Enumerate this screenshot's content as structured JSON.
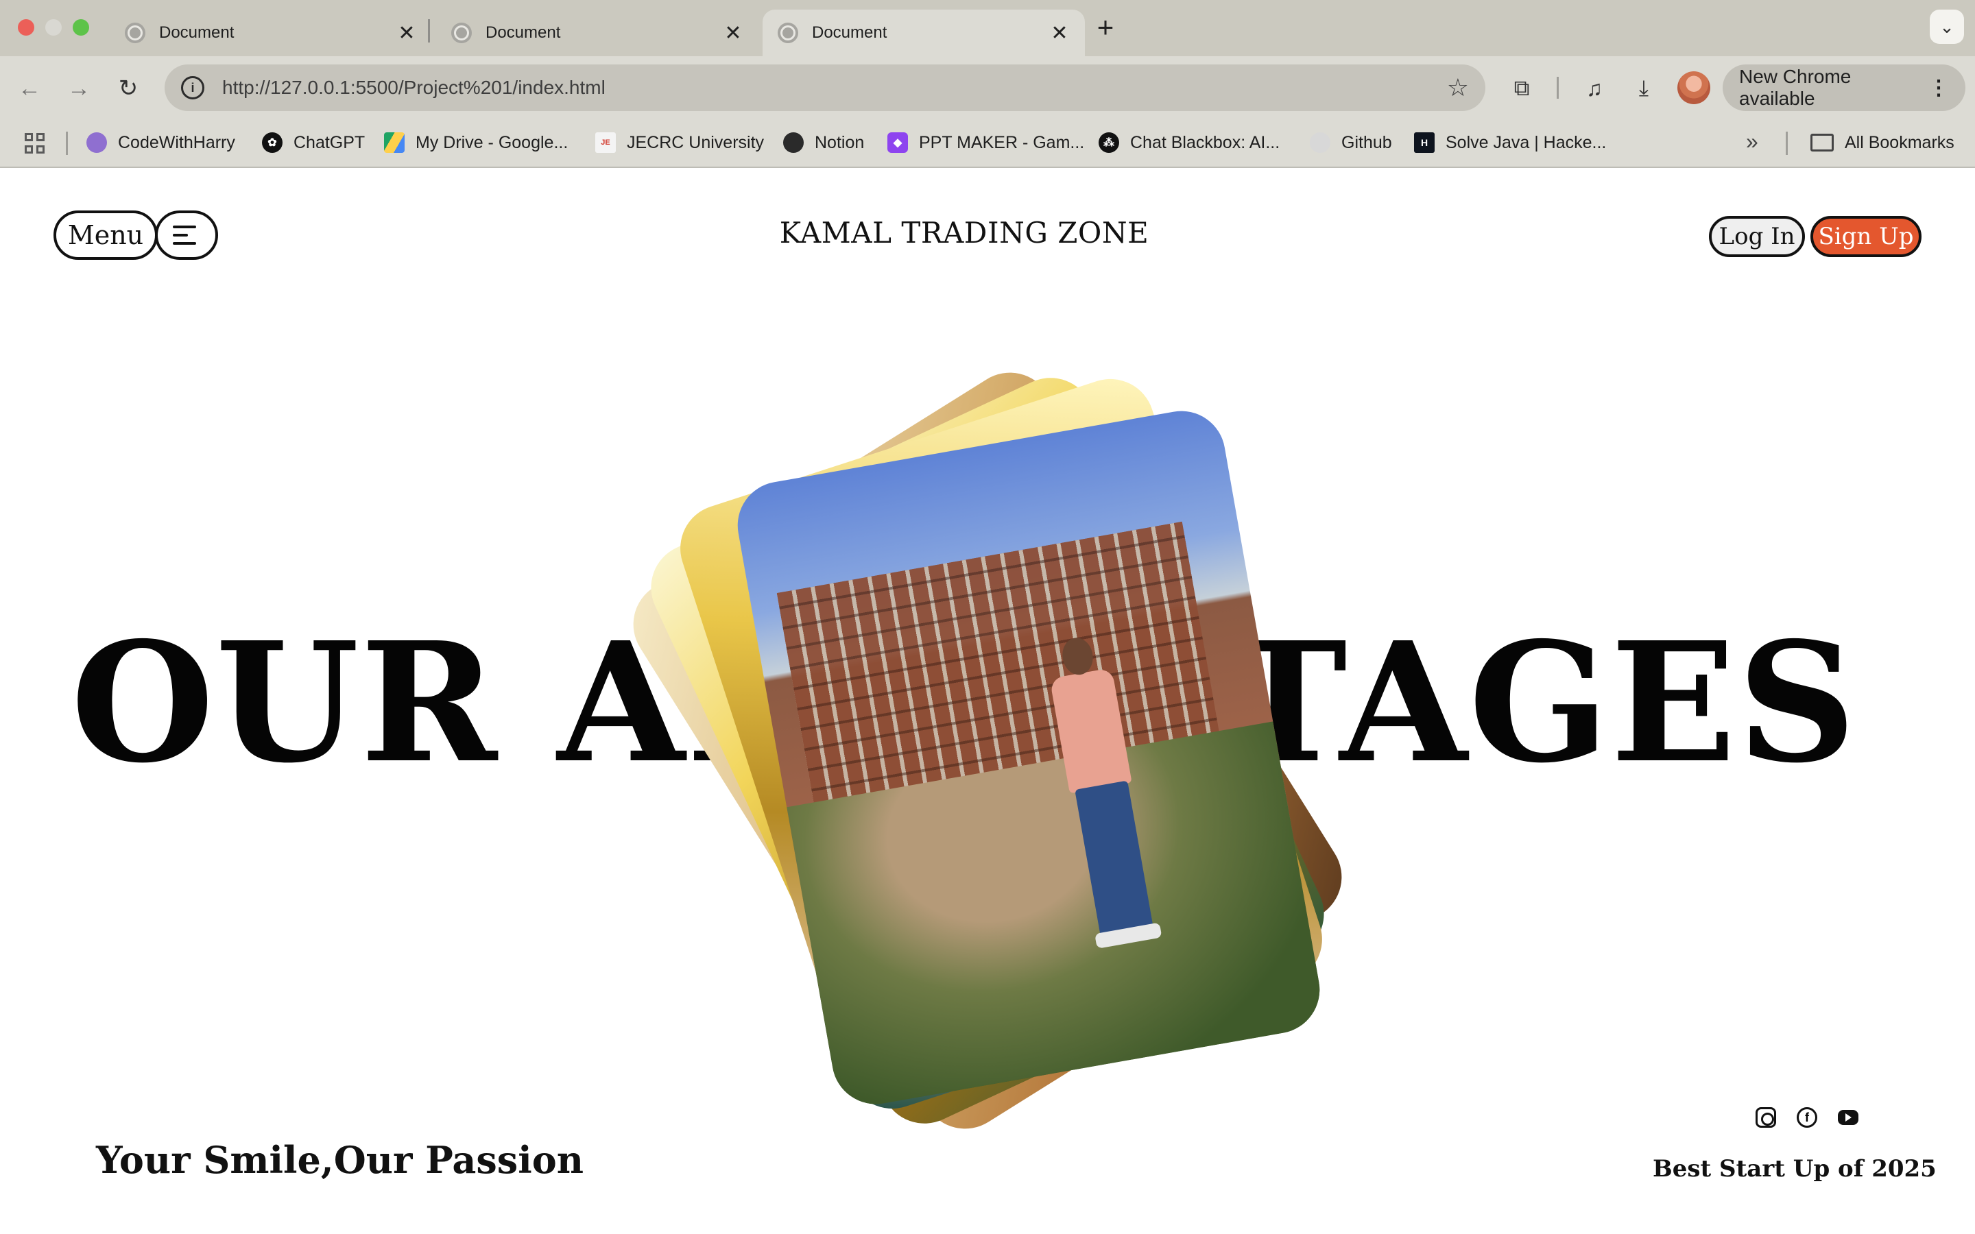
{
  "browser": {
    "tabs": [
      {
        "title": "Document",
        "active": false
      },
      {
        "title": "Document",
        "active": false
      },
      {
        "title": "Document",
        "active": true
      }
    ],
    "new_tab": "+",
    "close_glyph": "✕",
    "address_bar": {
      "url": "http://127.0.0.1:5500/Project%201/index.html"
    },
    "update_button": "New Chrome available",
    "bookmarks": [
      {
        "label": "CodeWithHarry",
        "icon": "avatar-icon",
        "color": "#8f6fd0"
      },
      {
        "label": "ChatGPT",
        "icon": "chatgpt-icon",
        "color": "#111111"
      },
      {
        "label": "My Drive - Google...",
        "icon": "google-drive-icon",
        "color": "#1fa463"
      },
      {
        "label": "JECRC University",
        "icon": "jecrc-icon",
        "color": "#d23b2f"
      },
      {
        "label": "Notion",
        "icon": "notion-icon",
        "color": "#2a2a2a"
      },
      {
        "label": "PPT MAKER - Gam...",
        "icon": "ppt-maker-icon",
        "color": "#8e44ef"
      },
      {
        "label": "Chat Blackbox: AI...",
        "icon": "blackbox-icon",
        "color": "#111111"
      },
      {
        "label": "Github",
        "icon": "github-icon",
        "color": "#d8d8d8"
      },
      {
        "label": "Solve Java | Hacke...",
        "icon": "hackerrank-icon",
        "color": "#0e141e"
      }
    ],
    "all_bookmarks": "All Bookmarks"
  },
  "page": {
    "menu_label": "Menu",
    "brand": "KAMAL TRADING ZONE",
    "login_label": "Log In",
    "signup_label": "Sign Up",
    "hero_title": "OUR ADVANTAGES",
    "tagline": "Your Smile,Our Passion",
    "award": "Best Start Up of 2025",
    "social": [
      "instagram-icon",
      "facebook-icon",
      "youtube-icon"
    ]
  },
  "colors": {
    "signup_bg": "#e4572e",
    "tab_strip": "#cbc9bf",
    "toolbar": "#dcdbd4"
  }
}
